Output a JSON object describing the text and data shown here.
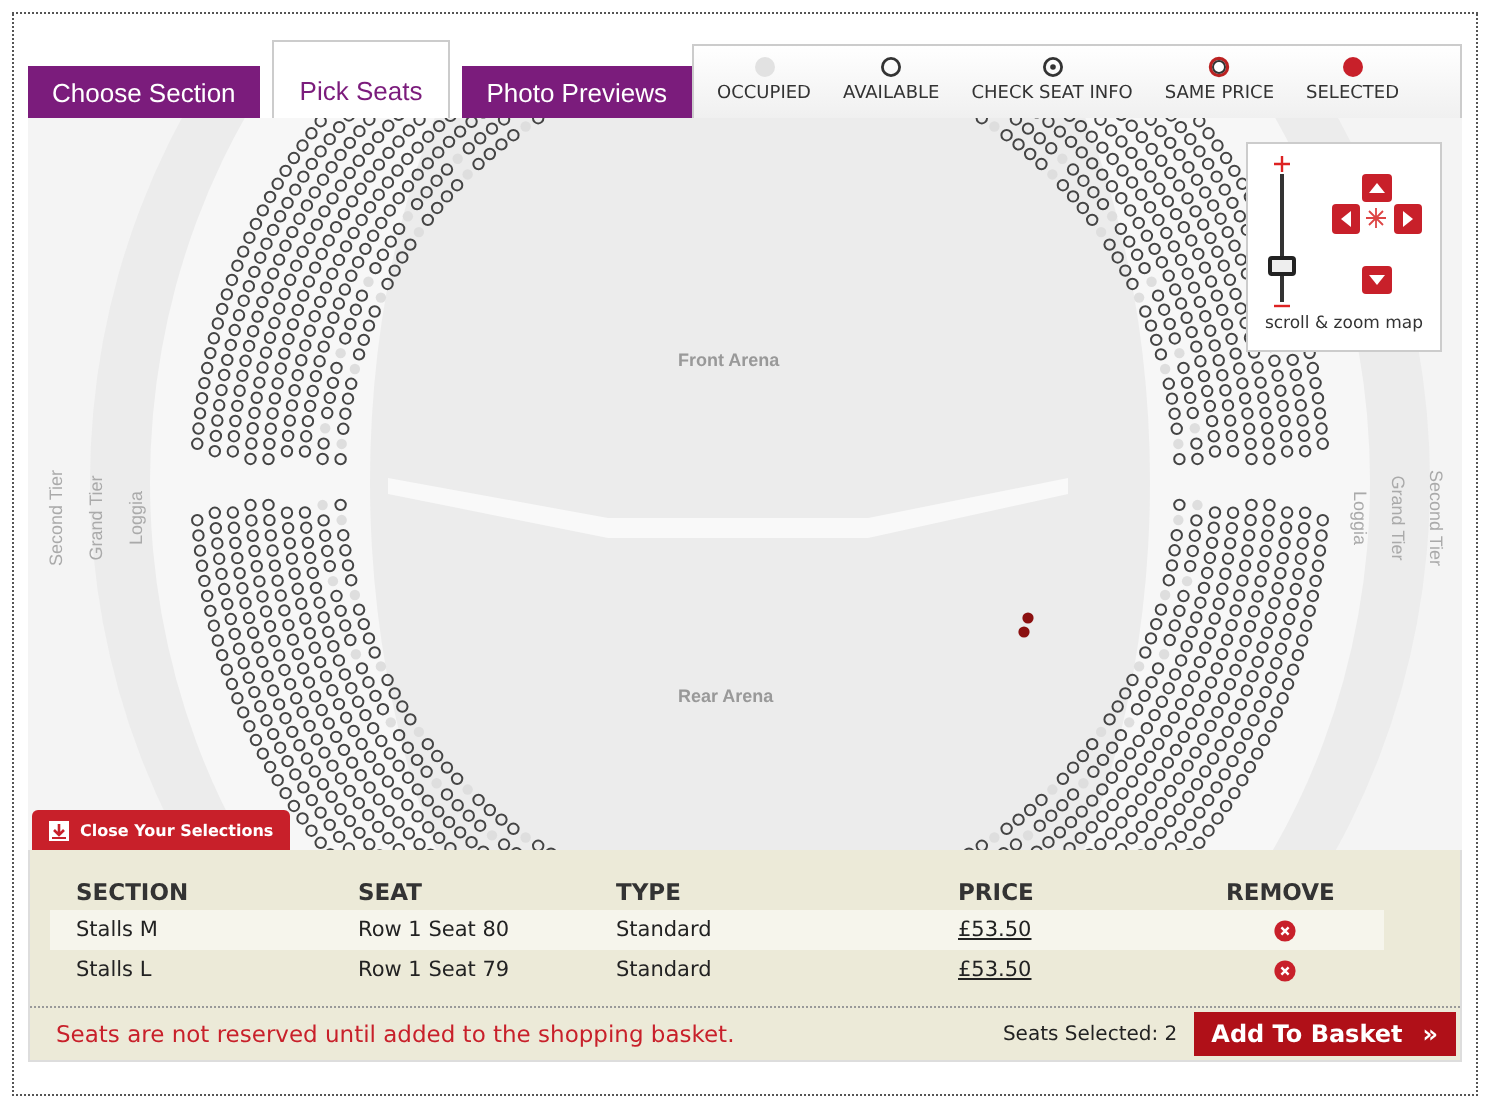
{
  "tabs": [
    {
      "label": "Choose Section",
      "selected": false
    },
    {
      "label": "Pick Seats",
      "selected": true
    },
    {
      "label": "Photo Previews",
      "selected": false
    }
  ],
  "legend": [
    {
      "label": "OCCUPIED",
      "kind": "occupied"
    },
    {
      "label": "AVAILABLE",
      "kind": "available"
    },
    {
      "label": "CHECK SEAT INFO",
      "kind": "check"
    },
    {
      "label": "SAME PRICE",
      "kind": "same_price"
    },
    {
      "label": "SELECTED",
      "kind": "selected"
    }
  ],
  "map": {
    "arena_labels": [
      "Front Arena",
      "Rear Arena"
    ],
    "left_tiers": [
      "Second Tier",
      "Grand Tier",
      "Loggia"
    ],
    "right_tiers": [
      "Loggia",
      "Grand Tier",
      "Second Tier"
    ]
  },
  "zoom_control": {
    "caption": "scroll & zoom map",
    "level": 0.28
  },
  "close_button": "Close Your Selections",
  "table": {
    "columns": [
      "SECTION",
      "SEAT",
      "TYPE",
      "PRICE",
      "REMOVE"
    ],
    "rows": [
      {
        "section": "Stalls M",
        "seat": "Row 1 Seat 80",
        "type": "Standard",
        "price": "£53.50"
      },
      {
        "section": "Stalls L",
        "seat": "Row 1 Seat 79",
        "type": "Standard",
        "price": "£53.50"
      }
    ]
  },
  "notice": "Seats are not reserved until added to the shopping basket.",
  "seats_selected": "Seats Selected: 2",
  "basket_button": {
    "label": "Add To Basket",
    "arrow": "»"
  }
}
